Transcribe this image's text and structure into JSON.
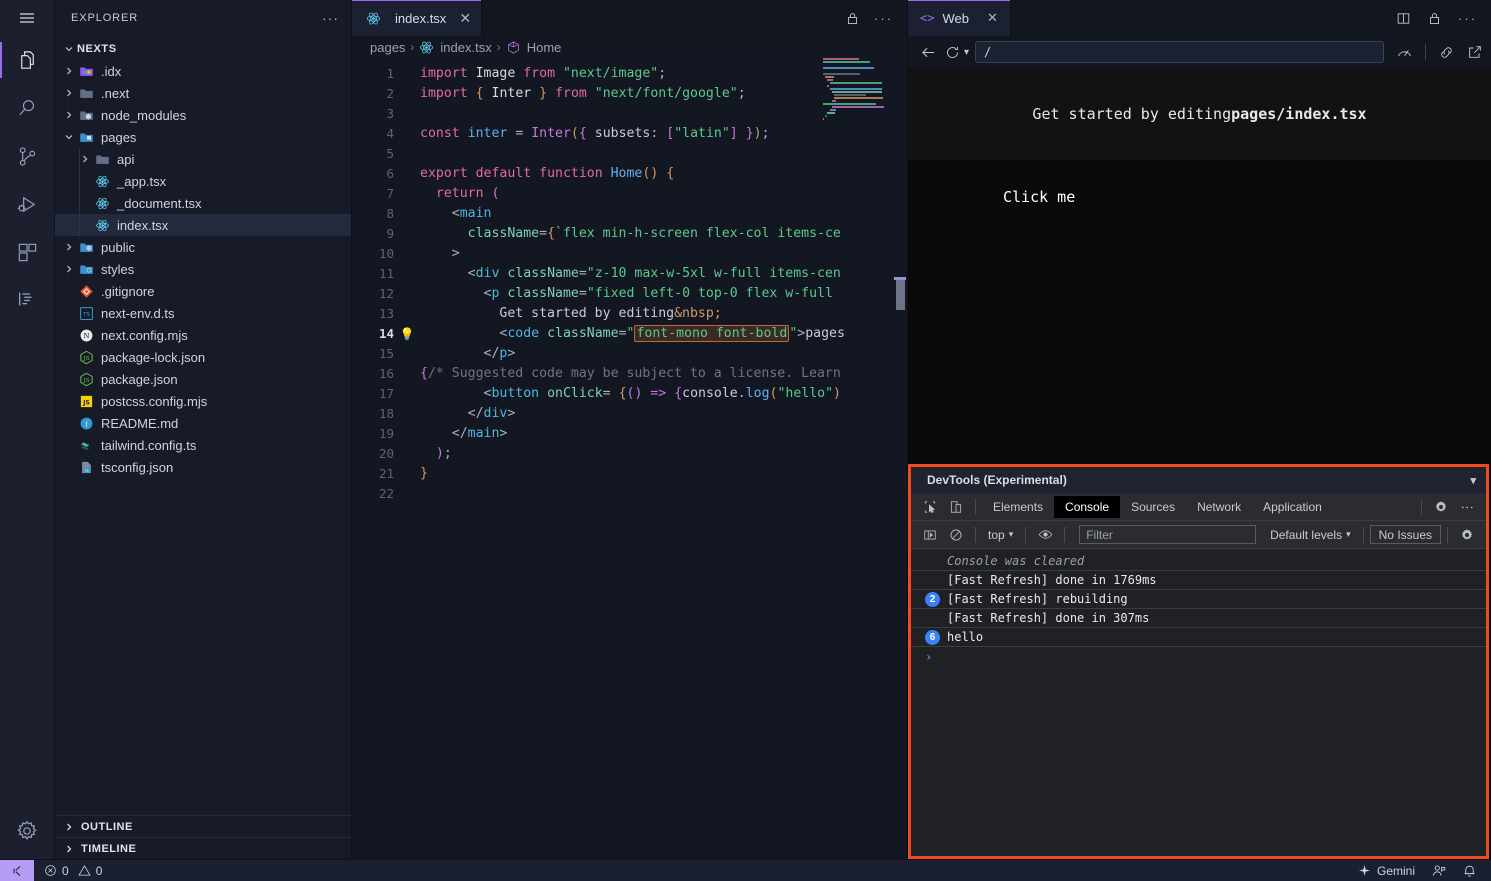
{
  "activity_bar": {
    "menu_label": "menu",
    "items": [
      {
        "name": "explorer",
        "icon": "files-icon",
        "active": true
      },
      {
        "name": "search",
        "icon": "search-icon",
        "active": false
      },
      {
        "name": "source-control",
        "icon": "source-control-icon",
        "active": false
      },
      {
        "name": "run-and-debug",
        "icon": "run-debug-icon",
        "active": false
      },
      {
        "name": "extensions",
        "icon": "extensions-icon",
        "active": false
      },
      {
        "name": "outline-view",
        "icon": "list-tree-icon",
        "active": false
      }
    ],
    "settings_icon": "gear-icon"
  },
  "sidebar": {
    "title": "EXPLORER",
    "more_actions": "···",
    "root": {
      "label": "NEXTS",
      "expanded": true
    },
    "tree": [
      {
        "label": ".idx",
        "depth": 1,
        "type": "folder",
        "expanded": false,
        "icon": "folder-idx-icon",
        "selected": false
      },
      {
        "label": ".next",
        "depth": 1,
        "type": "folder",
        "expanded": false,
        "icon": "folder-icon",
        "selected": false
      },
      {
        "label": "node_modules",
        "depth": 1,
        "type": "folder",
        "expanded": false,
        "icon": "folder-node-icon",
        "selected": false
      },
      {
        "label": "pages",
        "depth": 1,
        "type": "folder",
        "expanded": true,
        "icon": "folder-open-icon",
        "selected": false
      },
      {
        "label": "api",
        "depth": 2,
        "type": "folder",
        "expanded": false,
        "icon": "folder-icon",
        "selected": false
      },
      {
        "label": "_app.tsx",
        "depth": 2,
        "type": "file",
        "icon": "react-icon",
        "selected": false
      },
      {
        "label": "_document.tsx",
        "depth": 2,
        "type": "file",
        "icon": "react-icon",
        "selected": false
      },
      {
        "label": "index.tsx",
        "depth": 2,
        "type": "file",
        "icon": "react-icon",
        "selected": true
      },
      {
        "label": "public",
        "depth": 1,
        "type": "folder",
        "expanded": false,
        "icon": "folder-public-icon",
        "selected": false
      },
      {
        "label": "styles",
        "depth": 1,
        "type": "folder",
        "expanded": false,
        "icon": "folder-style-icon",
        "selected": false
      },
      {
        "label": ".gitignore",
        "depth": 1,
        "type": "file",
        "icon": "git-icon",
        "selected": false
      },
      {
        "label": "next-env.d.ts",
        "depth": 1,
        "type": "file",
        "icon": "ts-icon",
        "selected": false
      },
      {
        "label": "next.config.mjs",
        "depth": 1,
        "type": "file",
        "icon": "next-icon",
        "selected": false
      },
      {
        "label": "package-lock.json",
        "depth": 1,
        "type": "file",
        "icon": "npm-json-icon",
        "selected": false
      },
      {
        "label": "package.json",
        "depth": 1,
        "type": "file",
        "icon": "npm-json-icon",
        "selected": false
      },
      {
        "label": "postcss.config.mjs",
        "depth": 1,
        "type": "file",
        "icon": "js-icon",
        "selected": false
      },
      {
        "label": "README.md",
        "depth": 1,
        "type": "file",
        "icon": "info-icon",
        "selected": false
      },
      {
        "label": "tailwind.config.ts",
        "depth": 1,
        "type": "file",
        "icon": "tailwind-icon",
        "selected": false
      },
      {
        "label": "tsconfig.json",
        "depth": 1,
        "type": "file",
        "icon": "tsconfig-icon",
        "selected": false
      }
    ],
    "sections": [
      {
        "label": "OUTLINE",
        "expanded": false
      },
      {
        "label": "TIMELINE",
        "expanded": false
      }
    ]
  },
  "editor": {
    "tab": {
      "label": "index.tsx",
      "icon": "react-icon",
      "close": "✕"
    },
    "actions": [
      {
        "name": "lock-editor",
        "icon": "lock-icon"
      },
      {
        "name": "more-actions",
        "icon": "ellipsis-icon"
      }
    ],
    "breadcrumb": [
      {
        "label": "pages",
        "icon": null
      },
      {
        "label": "index.tsx",
        "icon": "react-icon"
      },
      {
        "label": "Home",
        "icon": "symbol-method-icon"
      }
    ],
    "breadcrumb_separator": "›",
    "line_count": 22,
    "current_line": 14,
    "lightbulb_line": 14,
    "highlighted_text": "font-mono font-bold",
    "lines": [
      {
        "n": 1,
        "text": "import Image from \"next/image\";"
      },
      {
        "n": 2,
        "text": "import { Inter } from \"next/font/google\";"
      },
      {
        "n": 3,
        "text": ""
      },
      {
        "n": 4,
        "text": "const inter = Inter({ subsets: [\"latin\"] });"
      },
      {
        "n": 5,
        "text": ""
      },
      {
        "n": 6,
        "text": "export default function Home() {"
      },
      {
        "n": 7,
        "text": "  return ("
      },
      {
        "n": 8,
        "text": "    <main"
      },
      {
        "n": 9,
        "text": "      className={`flex min-h-screen flex-col items-ce"
      },
      {
        "n": 10,
        "text": "    >"
      },
      {
        "n": 11,
        "text": "      <div className=\"z-10 max-w-5xl w-full items-cen"
      },
      {
        "n": 12,
        "text": "        <p className=\"fixed left-0 top-0 flex w-full"
      },
      {
        "n": 13,
        "text": "          Get started by editing&nbsp;"
      },
      {
        "n": 14,
        "text": "          <code className=\"font-mono font-bold\">pages"
      },
      {
        "n": 15,
        "text": "        </p>"
      },
      {
        "n": 16,
        "text": "{/* Suggested code may be subject to a license. Learn"
      },
      {
        "n": 17,
        "text": "        <button onClick= {() => {console.log(\"hello\")"
      },
      {
        "n": 18,
        "text": "      </div>"
      },
      {
        "n": 19,
        "text": "    </main>"
      },
      {
        "n": 20,
        "text": "  );"
      },
      {
        "n": 21,
        "text": "}"
      },
      {
        "n": 22,
        "text": ""
      }
    ]
  },
  "web_panel": {
    "tab": {
      "label": "Web",
      "icon": "code-brackets-icon",
      "close": "✕"
    },
    "actions": [
      {
        "name": "split-editor",
        "icon": "split-icon"
      },
      {
        "name": "lock-panel",
        "icon": "lock-icon"
      },
      {
        "name": "more-actions",
        "icon": "ellipsis-icon"
      }
    ],
    "toolbar": {
      "back": "back-arrow-icon",
      "reload": "reload-icon",
      "reload_dropdown": "chevron-down-icon",
      "url_value": "/",
      "url_placeholder": "/",
      "right_icons": [
        {
          "name": "performance-insights",
          "icon": "speedometer-icon"
        },
        {
          "name": "devtools-link",
          "icon": "chain-link-icon"
        },
        {
          "name": "open-external",
          "icon": "external-link-icon"
        }
      ]
    },
    "preview": {
      "headline_prefix": "Get started by editing ",
      "headline_bold": "pages/index.tsx",
      "button_label": "Click me"
    }
  },
  "devtools": {
    "title": "DevTools (Experimental)",
    "collapse_icon": "chevron-down-icon",
    "tool_icons": [
      {
        "name": "inspect-element",
        "icon": "inspect-cursor-icon"
      },
      {
        "name": "device-toolbar",
        "icon": "device-toggle-icon"
      }
    ],
    "tabs": [
      {
        "label": "Elements",
        "active": false
      },
      {
        "label": "Console",
        "active": true
      },
      {
        "label": "Sources",
        "active": false
      },
      {
        "label": "Network",
        "active": false
      },
      {
        "label": "Application",
        "active": false
      }
    ],
    "tabbar_right": [
      {
        "name": "devtools-settings",
        "icon": "gear-icon"
      },
      {
        "name": "devtools-menu",
        "icon": "kebab-icon"
      }
    ],
    "console_toolbar": {
      "sidebar_toggle": "console-sidebar-icon",
      "clear": "clear-console-icon",
      "context_label": "top",
      "context_caret": "▾",
      "eye": "live-expression-icon",
      "filter_placeholder": "Filter",
      "filter_value": "",
      "levels_label": "Default levels",
      "levels_caret": "▾",
      "issues_label": "No Issues",
      "settings": "gear-icon"
    },
    "messages": [
      {
        "badge": null,
        "text": "Console was cleared",
        "style": "cleared"
      },
      {
        "badge": null,
        "text": "[Fast Refresh] done in 1769ms",
        "style": "normal"
      },
      {
        "badge": "2",
        "text": "[Fast Refresh] rebuilding",
        "style": "normal"
      },
      {
        "badge": null,
        "text": "[Fast Refresh] done in 307ms",
        "style": "normal"
      },
      {
        "badge": "6",
        "text": "hello",
        "style": "normal"
      }
    ],
    "prompt": "›"
  },
  "status_bar": {
    "remote_icon": "remote-indicator-icon",
    "errors_icon": "error-circle-icon",
    "errors": "0",
    "warnings_icon": "warning-triangle-icon",
    "warnings": "0",
    "gemini_label": "Gemini",
    "gemini_icon": "sparkle-icon",
    "right_icons": [
      {
        "name": "account",
        "icon": "account-icon"
      },
      {
        "name": "notifications",
        "icon": "bell-icon"
      }
    ]
  },
  "colors": {
    "accent": "#9b6cf2",
    "devtools_border": "#f04a1e",
    "status_remote_bg": "#b79cf5",
    "editor_bg": "#131722",
    "sidebar_bg": "#171b27",
    "devtools_bg": "#202124",
    "badge_blue": "#3b82f6",
    "highlight_border": "#c4663a"
  }
}
